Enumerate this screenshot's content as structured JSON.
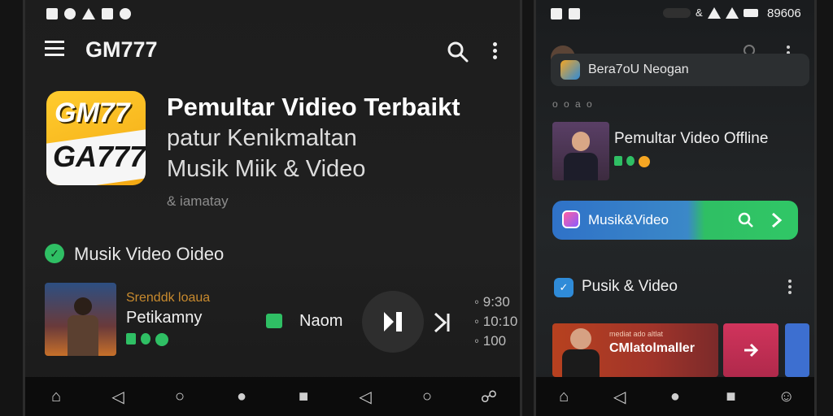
{
  "left": {
    "app_title": "GM777",
    "logo_top": "GM77",
    "logo_bottom": "GA777",
    "hero_title": "Pemultar Vidieo Terbaikt",
    "hero_line2": "patur Kenikmaltan",
    "hero_line3": "Musik Miik & Video",
    "hero_caption": "& iamatay",
    "section_title": "Musik Video Oideo",
    "track_artist": "Srenddk loaua",
    "track_title": "Petikamny",
    "now_label": "Naom",
    "side_stats": [
      "◦ 9:30",
      "◦ 10:10",
      "◦ 100"
    ]
  },
  "right": {
    "status_time": "89606",
    "banner_text": "Bera7oU Neogan",
    "meta_text": "o o a o",
    "card_title": "Pemultar Video Offline",
    "search_pill_text": "Musik&Video",
    "section_title": "Pusik & Video",
    "thumb_caption": "CMlatolmaller",
    "thumb_small": "mediat ado altlat"
  },
  "colors": {
    "accent_green": "#2fbf64",
    "accent_blue": "#2f8bd8",
    "accent_orange": "#f5a623",
    "logo_yellow": "#f3b515"
  },
  "icons": {
    "menu": "hamburger-icon",
    "search": "search-icon",
    "more": "more-vertical-icon",
    "play_pause": "play-pause-icon",
    "next": "skip-next-icon"
  }
}
